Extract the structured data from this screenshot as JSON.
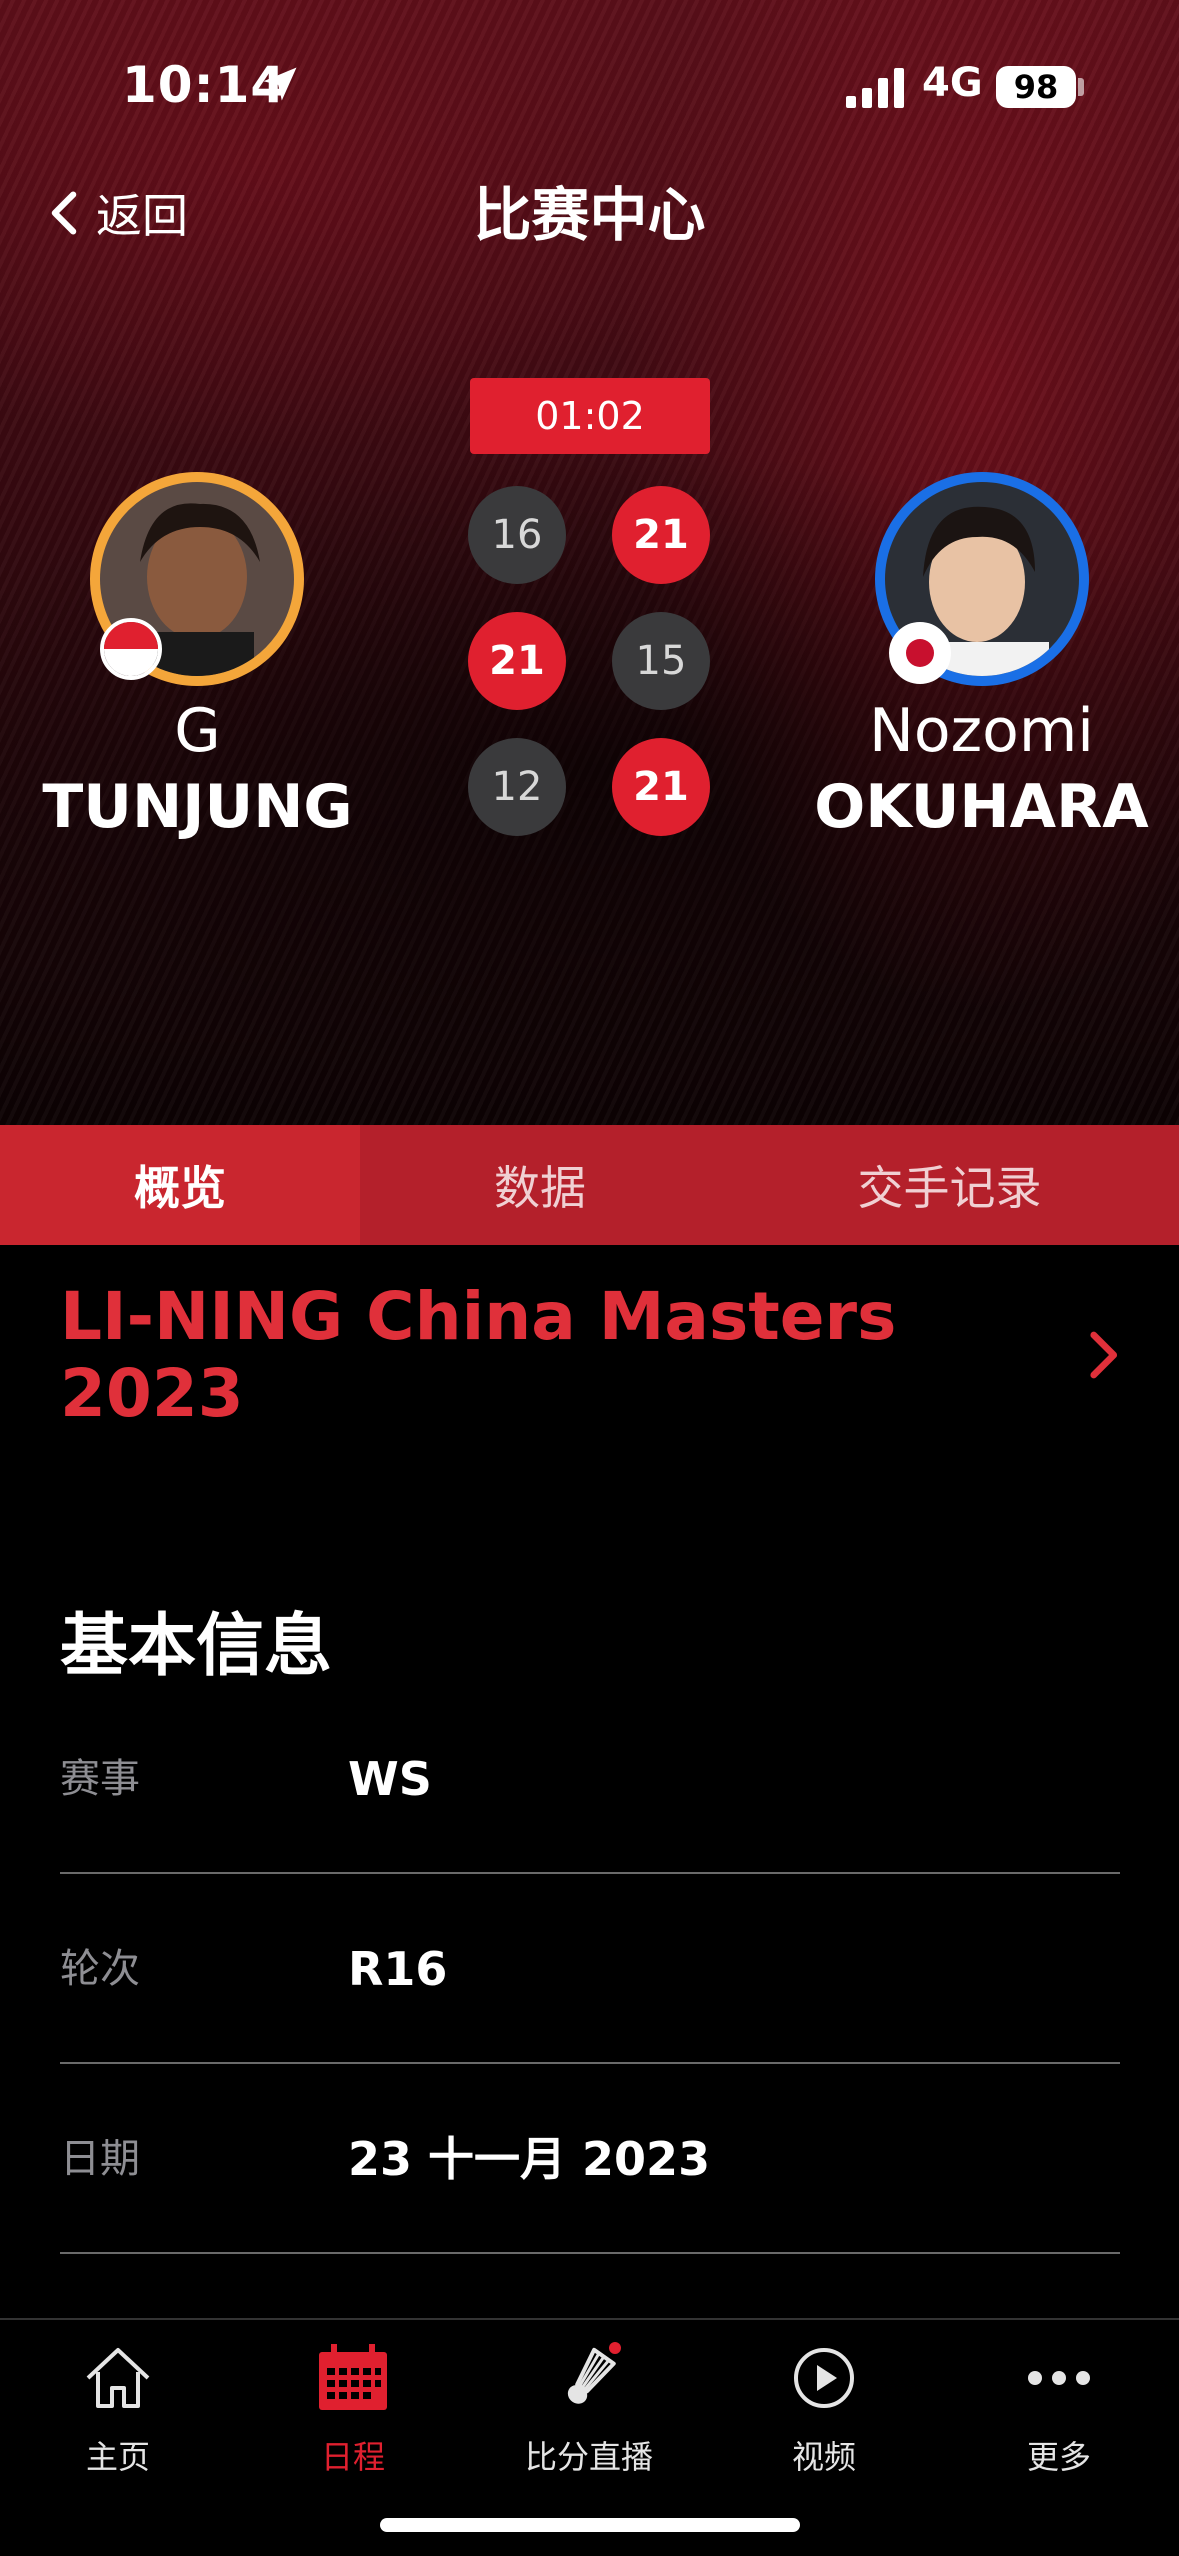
{
  "status_bar": {
    "time": "10:14",
    "network": "4G",
    "battery": "98"
  },
  "header": {
    "back_label": "返回",
    "title": "比赛中心"
  },
  "match": {
    "timer": "01:02",
    "games": [
      {
        "left": "16",
        "right": "21"
      },
      {
        "left": "21",
        "right": "15"
      },
      {
        "left": "12",
        "right": "21"
      }
    ],
    "player_left": {
      "first_name": "G",
      "last_name": "TUNJUNG",
      "ring_color": "#f4a63a",
      "flag": "Indonesia"
    },
    "player_right": {
      "first_name": "Nozomi",
      "last_name": "OKUHARA",
      "ring_color": "#1a6fe6",
      "flag": "Japan"
    }
  },
  "tabs": [
    {
      "label": "概览",
      "active": true
    },
    {
      "label": "数据",
      "active": false
    },
    {
      "label": "交手记录",
      "active": false
    }
  ],
  "tournament": {
    "name": "LI-NING China Masters 2023"
  },
  "basic_info": {
    "title": "基本信息",
    "rows": [
      {
        "label": "赛事",
        "value": "WS"
      },
      {
        "label": "轮次",
        "value": "R16"
      },
      {
        "label": "日期",
        "value": "23 十一月 2023"
      }
    ]
  },
  "bottom_nav": [
    {
      "label": "主页",
      "icon": "home-icon",
      "active": false
    },
    {
      "label": "日程",
      "icon": "calendar-icon",
      "active": true
    },
    {
      "label": "比分直播",
      "icon": "shuttlecock-icon",
      "active": false
    },
    {
      "label": "视频",
      "icon": "play-icon",
      "active": false
    },
    {
      "label": "更多",
      "icon": "more-icon",
      "active": false
    }
  ],
  "colors": {
    "accent": "#e0202f",
    "tab_bar": "#b4202b"
  }
}
